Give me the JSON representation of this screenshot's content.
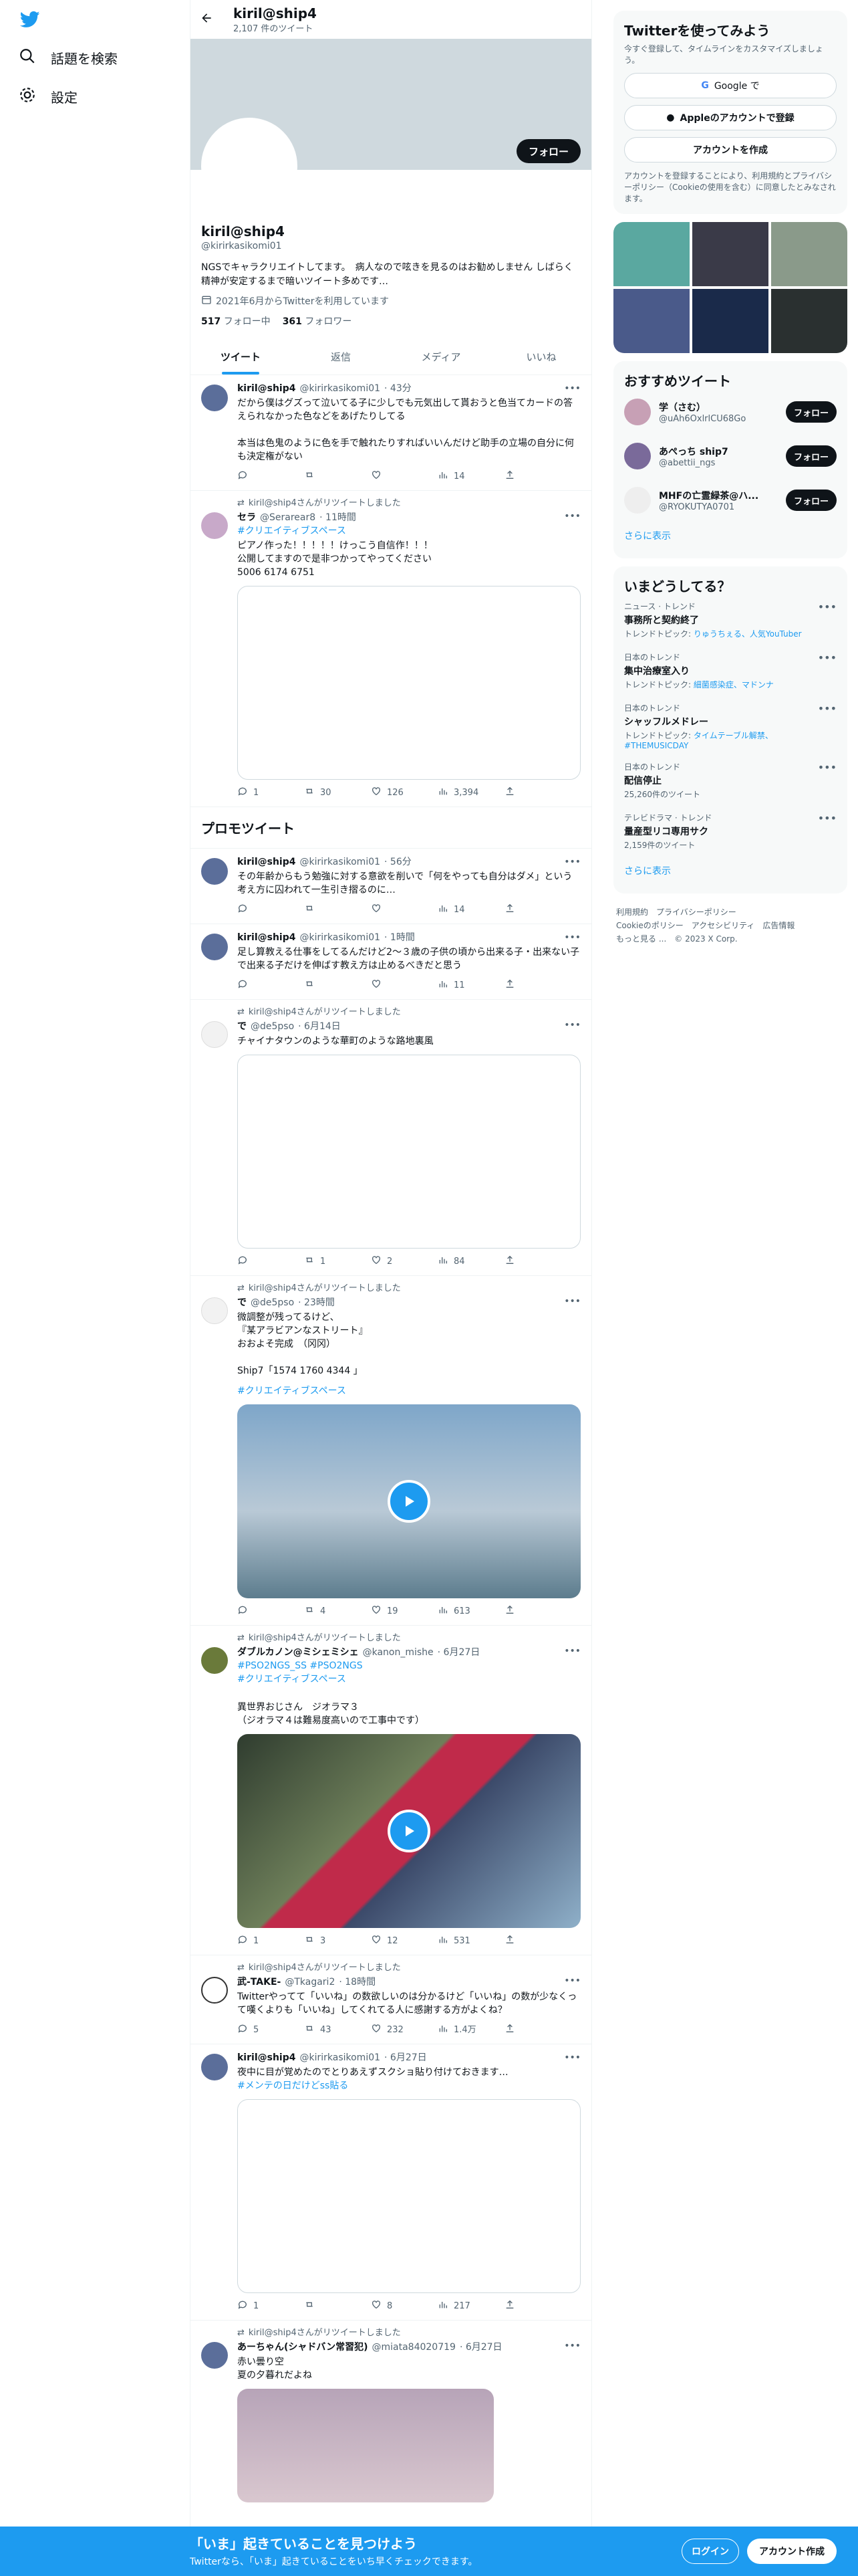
{
  "nav": {
    "explore": "話題を検索",
    "settings": "設定"
  },
  "header": {
    "name": "kiril@ship4",
    "count": "2,107 件のツイート"
  },
  "profile": {
    "follow": "フォロー",
    "name": "kiril@ship4",
    "handle": "@kirirkasikomi01",
    "bio": "NGSでキャラクリエイトしてます。　病人なので呟きを見るのはお勧めしません しばらく精神が安定するまで暗いツイート多めです…",
    "joined": "2021年6月からTwitterを利用しています",
    "following_num": "517",
    "following_label": "フォロー中",
    "followers_num": "361",
    "followers_label": "フォロワー"
  },
  "tabs": [
    "ツイート",
    "返信",
    "メディア",
    "いいね"
  ],
  "promo_title": "プロモツイート",
  "tweets": [
    {
      "name": "kiril@ship4",
      "handle": "@kirirkasikomi01",
      "time": "· 43分",
      "body": "だから僕はグズって泣いてる子に少しでも元気出して貰おうと色当てカードの答えられなかった色などをあげたりしてる\n\n本当は色鬼のように色を手で触れたりすればいいんだけど助手の立場の自分に何も決定権がない",
      "reply": "",
      "rt": "",
      "like": "",
      "views": "14"
    },
    {
      "rt_by": "kiril@ship4さんがリツイートしました",
      "name": "セラ",
      "handle": "@Serarear8",
      "time": "· 11時間",
      "tag": "#クリエイティブスペース",
      "body": "ピアノ作った！！！！！けっこう自信作！！！\n公開してますので是非つかってやってください\n5006 6174 6751",
      "reply": "1",
      "rt": "30",
      "like": "126",
      "views": "3,394"
    },
    {
      "name": "kiril@ship4",
      "handle": "@kirirkasikomi01",
      "time": "· 56分",
      "body": "その年齢からもう勉強に対する意欲を削いで「何をやっても自分はダメ」という考え方に囚われて一生引き摺るのに…",
      "reply": "",
      "rt": "",
      "like": "",
      "views": "14"
    },
    {
      "name": "kiril@ship4",
      "handle": "@kirirkasikomi01",
      "time": "· 1時間",
      "body": "足し算教える仕事をしてるんだけど2〜３歳の子供の頃から出来る子・出来ない子で出来る子だけを伸ばす教え方は止めるべきだと思う",
      "reply": "",
      "rt": "",
      "like": "",
      "views": "11"
    },
    {
      "rt_by": "kiril@ship4さんがリツイートしました",
      "name": "で",
      "handle": "@de5pso",
      "time": "· 6月14日",
      "body": "チャイナタウンのような華町のような路地裏風",
      "reply": "",
      "rt": "1",
      "like": "2",
      "views": "84"
    },
    {
      "rt_by": "kiril@ship4さんがリツイートしました",
      "name": "で",
      "handle": "@de5pso",
      "time": "· 23時間",
      "body": "微調整が残ってるけど、\n『某アラビアンなストリート』\nおおよそ完成　（冈冈）\n\nShip7「1574 1760 4344 」",
      "tag": "#クリエイティブスペース",
      "reply": "",
      "rt": "4",
      "like": "19",
      "views": "613"
    },
    {
      "rt_by": "kiril@ship4さんがリツイートしました",
      "name": "ダブルカノン@ミシェミシェ",
      "handle": "@kanon_mishe",
      "time": "· 6月27日",
      "tag": "#PSO2NGS_SS #PSO2NGS\n#クリエイティブスペース",
      "body": "\n異世界おじさん　ジオラマ３\n（ジオラマ４は難易度高いので工事中です）",
      "reply": "1",
      "rt": "3",
      "like": "12",
      "views": "531"
    },
    {
      "rt_by": "kiril@ship4さんがリツイートしました",
      "name": "武-TAKE-",
      "handle": "@Tkagari2",
      "time": "· 18時間",
      "body": "Twitterやってて「いいね」の数欲しいのは分かるけど「いいね」の数が少なくって嘆くよりも「いいね」してくれてる人に感謝する方がよくね？",
      "reply": "5",
      "rt": "43",
      "like": "232",
      "views": "1.4万"
    },
    {
      "name": "kiril@ship4",
      "handle": "@kirirkasikomi01",
      "time": "· 6月27日",
      "body": "夜中に目が覚めたのでとりあえずスクショ貼り付けておきます…",
      "tag": "#メンテの日だけどss貼る",
      "reply": "1",
      "rt": "",
      "like": "8",
      "views": "217"
    },
    {
      "rt_by": "kiril@ship4さんがリツイートしました",
      "name": "あーちゃん(シャドバン常習犯)",
      "handle": "@miata84020719",
      "time": "· 6月27日",
      "body": "赤い曇り空\n夏の夕暮れだよね"
    }
  ],
  "right": {
    "signup_title": "Twitterを使ってみよう",
    "signup_sub": "今すぐ登録して、タイムラインをカスタマイズしましょう。",
    "google": "Google で",
    "apple": "Appleのアカウントで登録",
    "create": "アカウントを作成",
    "terms": "アカウントを登録することにより、利用規約とプライバシーポリシー（Cookieの使用を含む）に同意したとみなされます。",
    "rec_title": "おすすめツイート",
    "rec": [
      {
        "name": "学（さむ）",
        "handle": "@uAh6OxlrlCU68Go",
        "btn": "フォロー"
      },
      {
        "name": "あぺっち ship7",
        "handle": "@abettii_ngs",
        "btn": "フォロー"
      },
      {
        "name": "MHFの亡霊緑茶@ハ...",
        "handle": "@RYOKUTYA0701",
        "btn": "フォロー"
      }
    ],
    "more": "さらに表示",
    "trend_title": "いまどうしてる？",
    "trends": [
      {
        "cat": "ニュース · トレンド",
        "name": "事務所と契約終了",
        "sub": "トレンドトピック: ",
        "link": "りゅうちぇる、人気YouTuber"
      },
      {
        "cat": "日本のトレンド",
        "name": "集中治療室入り",
        "sub": "トレンドトピック: ",
        "link": "細菌感染症、マドンナ"
      },
      {
        "cat": "日本のトレンド",
        "name": "シャッフルメドレー",
        "sub": "トレンドトピック: ",
        "link": "タイムテーブル解禁、#THEMUSICDAY"
      },
      {
        "cat": "日本のトレンド",
        "name": "配信停止",
        "sub": "25,260件のツイート",
        "link": ""
      },
      {
        "cat": "テレビドラマ · トレンド",
        "name": "量産型リコ専用サク",
        "sub": "2,159件のツイート",
        "link": ""
      }
    ],
    "trend_more": "さらに表示",
    "footer": "利用規約　プライバシーポリシー\nCookieのポリシー　アクセシビリティ　広告情報\nもっと見る ...　© 2023 X Corp."
  },
  "bottom": {
    "title": "「いま」起きていることを見つけよう",
    "sub": "Twitterなら、「いま」起きていることをいち早くチェックできます。",
    "login": "ログイン",
    "signup": "アカウント作成"
  },
  "colors": {
    "accent": "#1d9bf0",
    "text": "#0f1419",
    "muted": "#536471"
  }
}
